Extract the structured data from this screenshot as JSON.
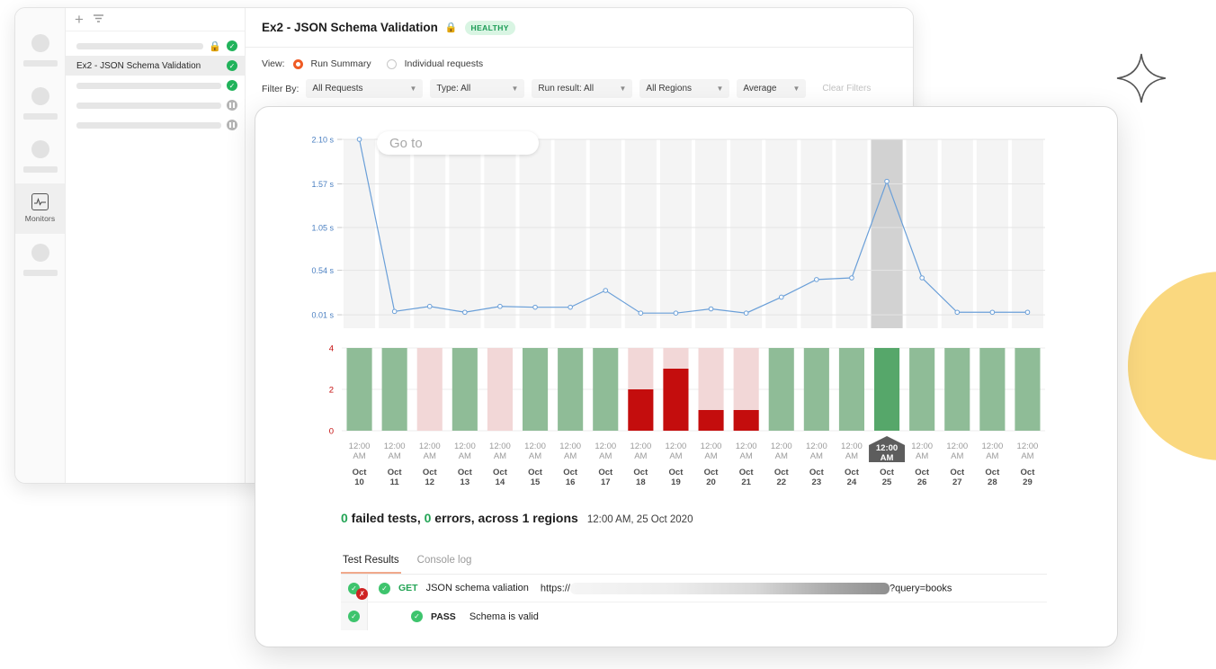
{
  "rail": {
    "items": [
      {
        "name": "rail-placeholder-1",
        "type": "skeleton"
      },
      {
        "name": "rail-placeholder-2",
        "type": "skeleton"
      },
      {
        "name": "rail-placeholder-3",
        "type": "skeleton"
      },
      {
        "name": "rail-monitors",
        "type": "icon",
        "label": "Monitors",
        "icon": "activity-pulse-icon"
      },
      {
        "name": "rail-placeholder-4",
        "type": "skeleton"
      }
    ]
  },
  "list": {
    "add_label": "+",
    "filter_icon": "filter-icon",
    "rows": [
      {
        "text": "",
        "skeleton": true,
        "lock": true,
        "status": "ok"
      },
      {
        "text": "Ex2 - JSON Schema Validation",
        "skeleton": false,
        "lock": false,
        "status": "ok",
        "selected": true
      },
      {
        "text": "",
        "skeleton": true,
        "lock": false,
        "status": "ok"
      },
      {
        "text": "",
        "skeleton": true,
        "lock": false,
        "status": "paused"
      },
      {
        "text": "",
        "skeleton": true,
        "lock": false,
        "status": "paused"
      }
    ]
  },
  "header": {
    "title": "Ex2 - JSON Schema Validation",
    "lock_icon": "lock-icon",
    "status_badge": "HEALTHY"
  },
  "view": {
    "label": "View:",
    "options": [
      {
        "label": "Run Summary",
        "selected": true
      },
      {
        "label": "Individual requests",
        "selected": false
      }
    ]
  },
  "filters": {
    "label": "Filter By:",
    "dropdowns": [
      {
        "value": "All Requests",
        "width": 130
      },
      {
        "value": "Type: All",
        "width": 105
      },
      {
        "value": "Run result: All",
        "width": 110
      },
      {
        "value": "All Regions",
        "width": 100
      },
      {
        "value": "Average",
        "width": 77
      }
    ],
    "clear_label": "Clear Filters"
  },
  "search_overlay": {
    "placeholder": "Go to",
    "value": ""
  },
  "summary": {
    "failed_count": "0",
    "failed_text": " failed tests, ",
    "errors_count": "0",
    "errors_text": " errors, across 1 regions",
    "date": "12:00 AM, 25 Oct 2020"
  },
  "tabs": [
    {
      "label": "Test Results",
      "active": true
    },
    {
      "label": "Console log",
      "active": false
    }
  ],
  "results": [
    {
      "gutter_status": "ok-with-error",
      "row_status": "ok",
      "method": "GET",
      "name": "JSON schema valiation",
      "url_prefix": "https://",
      "url_suffix": "?query=books"
    },
    {
      "gutter_status": "ok",
      "row_status": "ok",
      "method": "PASS",
      "name": "Schema is valid",
      "url_prefix": "",
      "url_suffix": ""
    }
  ],
  "chart_data": [
    {
      "type": "line",
      "title": "",
      "xlabel": "",
      "ylabel": "",
      "ytick_labels": [
        "2.10 s",
        "1.57 s",
        "1.05 s",
        "0.54 s",
        "0.01 s"
      ],
      "ytick_values": [
        2.1,
        1.57,
        1.05,
        0.54,
        0.01
      ],
      "ylim": [
        0.01,
        2.1
      ],
      "grid": true,
      "legend": "none",
      "line_color": "#6a9fd8",
      "x": [
        "Oct 10",
        "Oct 11",
        "Oct 12",
        "Oct 13",
        "Oct 14",
        "Oct 15",
        "Oct 16",
        "Oct 17",
        "Oct 18",
        "Oct 19",
        "Oct 20",
        "Oct 21",
        "Oct 22",
        "Oct 23",
        "Oct 24",
        "Oct 25",
        "Oct 26",
        "Oct 27",
        "Oct 28",
        "Oct 29"
      ],
      "values": [
        2.1,
        0.05,
        0.11,
        0.04,
        0.11,
        0.1,
        0.1,
        0.3,
        0.03,
        0.03,
        0.08,
        0.03,
        0.22,
        0.43,
        0.45,
        1.6,
        0.45,
        0.04,
        0.04,
        0.04
      ],
      "highlight_index": 15
    },
    {
      "type": "bar",
      "title": "",
      "xlabel": "",
      "ylabel": "",
      "ytick_labels": [
        "0",
        "2",
        "4"
      ],
      "ylim": [
        0,
        4
      ],
      "categories": [
        "Oct 10",
        "Oct 11",
        "Oct 12",
        "Oct 13",
        "Oct 14",
        "Oct 15",
        "Oct 16",
        "Oct 17",
        "Oct 18",
        "Oct 19",
        "Oct 20",
        "Oct 21",
        "Oct 22",
        "Oct 23",
        "Oct 24",
        "Oct 25",
        "Oct 26",
        "Oct 27",
        "Oct 28",
        "Oct 29"
      ],
      "time_labels": [
        "12:00 AM",
        "12:00 AM",
        "12:00 AM",
        "12:00 AM",
        "12:00 AM",
        "12:00 AM",
        "12:00 AM",
        "12:00 AM",
        "12:00 AM",
        "12:00 AM",
        "12:00 AM",
        "12:00 AM",
        "12:00 AM",
        "12:00 AM",
        "12:00 AM",
        "12:00 AM",
        "12:00 AM",
        "12:00 AM",
        "12:00 AM",
        "12:00 AM"
      ],
      "series": [
        {
          "name": "total",
          "values": [
            4,
            4,
            4,
            4,
            4,
            4,
            4,
            4,
            4,
            4,
            4,
            4,
            4,
            4,
            4,
            4,
            4,
            4,
            4,
            4
          ]
        },
        {
          "name": "failed",
          "values": [
            0,
            0,
            0,
            0,
            0,
            0,
            0,
            0,
            2,
            3,
            1,
            1,
            0,
            0,
            0,
            0,
            0,
            0,
            0,
            0
          ]
        }
      ],
      "bar_kind": [
        "pass",
        "pass",
        "fail-bg",
        "pass",
        "fail-bg",
        "pass",
        "pass",
        "pass",
        "fail",
        "fail",
        "fail",
        "fail",
        "pass",
        "pass",
        "pass",
        "pass-selected",
        "pass",
        "pass",
        "pass",
        "pass"
      ],
      "colors": {
        "pass": "#8fbc97",
        "pass_selected": "#56a76a",
        "fail_bg": "#f2d7d7",
        "fail": "#c40d0d",
        "axis_text": "#c40d0d"
      },
      "selected_index": 15,
      "selected_label": "12:00 AM"
    }
  ],
  "colors": {
    "accent": "#ef5b25",
    "healthy": "#1a9b55",
    "deco_yellow": "#fad87f",
    "line_blue": "#6a9fd8"
  }
}
